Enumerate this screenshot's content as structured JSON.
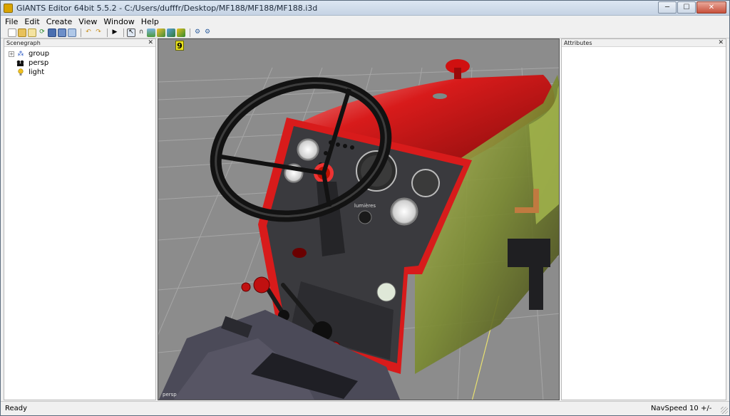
{
  "window": {
    "title": "GIANTS Editor 64bit 5.5.2 - C:/Users/dufffr/Desktop/MF188/MF188/MF188.i3d",
    "controls": {
      "minimize": "─",
      "maximize": "☐",
      "close": "✕"
    }
  },
  "menubar": {
    "items": [
      {
        "label": "File"
      },
      {
        "label": "Edit"
      },
      {
        "label": "Create"
      },
      {
        "label": "View"
      },
      {
        "label": "Window"
      },
      {
        "label": "Help"
      }
    ]
  },
  "toolbar": {
    "icons": [
      "new-file-icon",
      "open-file-icon",
      "edit-icon",
      "reload-icon",
      "save-icon",
      "save-as-icon",
      "export-icon",
      "undo-icon",
      "redo-icon",
      "play-icon",
      "select-icon",
      "magnet-icon",
      "terrain-icon",
      "paint-icon",
      "foliage-icon",
      "placement-icon",
      "settings-icon",
      "settings-alt-icon"
    ]
  },
  "scenegraph": {
    "header": "Scenegraph",
    "close": "✕",
    "nodes": [
      {
        "label": "group",
        "expander": "+",
        "icon": "group-icon",
        "icon_color": "#2050c0"
      },
      {
        "label": "persp",
        "icon": "camera-icon",
        "icon_color": "#111111"
      },
      {
        "label": "light",
        "icon": "light-icon",
        "icon_color": "#e0b000"
      }
    ]
  },
  "attributes": {
    "header": "Attributes",
    "close": "✕"
  },
  "viewport": {
    "camera_label": "persp",
    "gizmo_label": "9",
    "panel_text": "lumières"
  },
  "statusbar": {
    "status": "Ready",
    "navspeed": "NavSpeed 10 +/-"
  },
  "colors": {
    "tractor_red": "#d81b1b",
    "dashboard_gray": "#3a3a3e",
    "viewport_bg": "#8c8c8c",
    "grid_line": "#a6a6a6"
  }
}
